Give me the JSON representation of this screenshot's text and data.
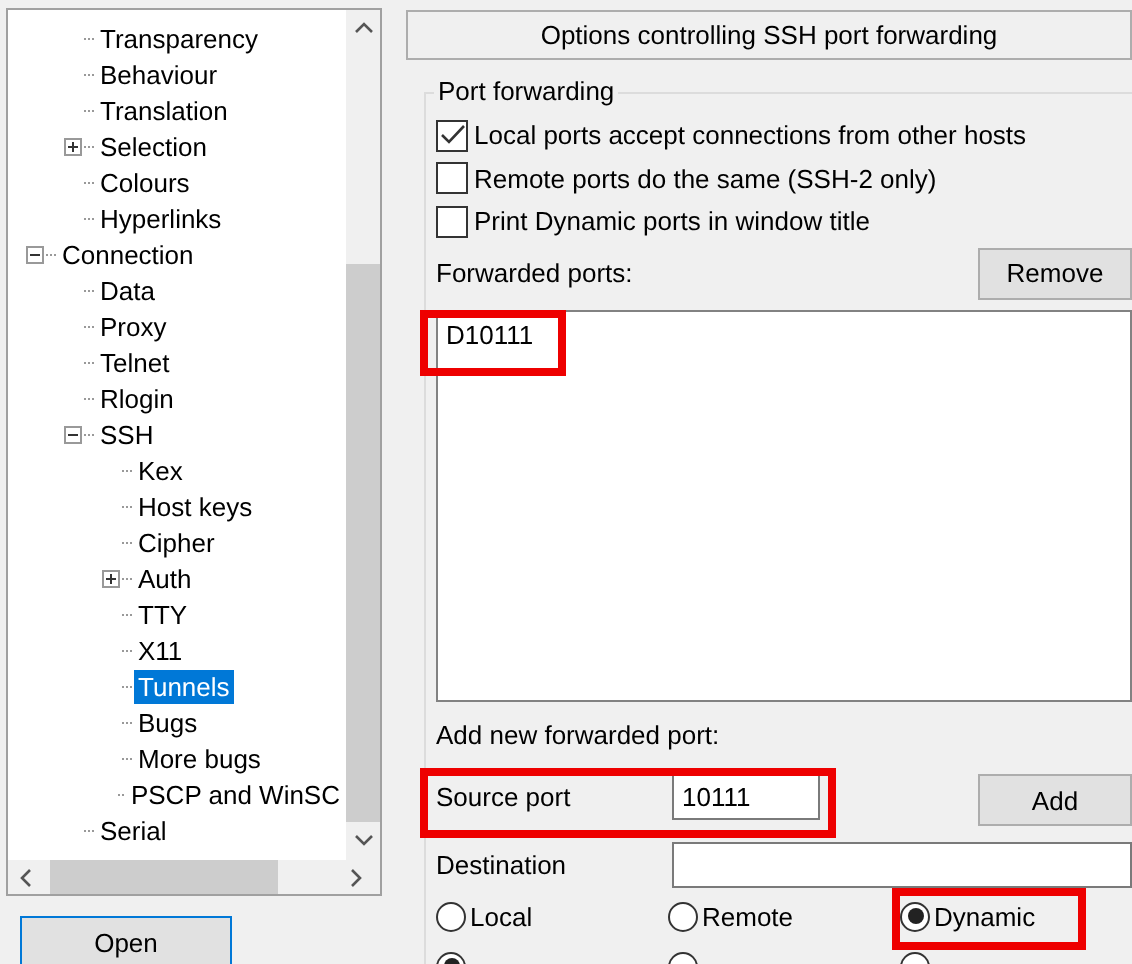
{
  "tree": [
    {
      "children": [
        {
          "label": "Transparency",
          "selected": false
        },
        {
          "label": "Behaviour",
          "selected": false
        },
        {
          "label": "Translation",
          "selected": false
        },
        {
          "label": "Selection",
          "selected": false,
          "expanded": false
        },
        {
          "label": "Colours",
          "selected": false
        },
        {
          "label": "Hyperlinks",
          "selected": false
        }
      ]
    },
    {
      "label": "Connection",
      "selected": false,
      "expanded": true,
      "children": [
        {
          "label": "Data",
          "selected": false
        },
        {
          "label": "Proxy",
          "selected": false
        },
        {
          "label": "Telnet",
          "selected": false
        },
        {
          "label": "Rlogin",
          "selected": false
        },
        {
          "label": "SSH",
          "selected": false,
          "expanded": true,
          "children": [
            {
              "label": "Kex",
              "selected": false
            },
            {
              "label": "Host keys",
              "selected": false
            },
            {
              "label": "Cipher",
              "selected": false
            },
            {
              "label": "Auth",
              "selected": false,
              "expanded": false
            },
            {
              "label": "TTY",
              "selected": false
            },
            {
              "label": "X11",
              "selected": false
            },
            {
              "label": "Tunnels",
              "selected": true
            },
            {
              "label": "Bugs",
              "selected": false
            },
            {
              "label": "More bugs",
              "selected": false
            },
            {
              "label": "PSCP and WinSC",
              "selected": false
            }
          ]
        },
        {
          "label": "Serial",
          "selected": false
        }
      ]
    }
  ],
  "open_button": "Open",
  "header": "Options controlling SSH port forwarding",
  "group_title": "Port forwarding",
  "options": [
    {
      "label": "Local ports accept connections from other hosts",
      "checked": true
    },
    {
      "label": "Remote ports do the same (SSH-2 only)",
      "checked": false
    },
    {
      "label": "Print Dynamic ports in window title",
      "checked": false
    }
  ],
  "forwarded_label": "Forwarded ports:",
  "remove_button": "Remove",
  "forwarded_ports": [
    "D10111"
  ],
  "add_label": "Add new forwarded port:",
  "source_label": "Source port",
  "source_value": "10111",
  "add_button": "Add",
  "destination_label": "Destination",
  "direction": [
    {
      "label": "Local",
      "selected": false
    },
    {
      "label": "Remote",
      "selected": false
    },
    {
      "label": "Dynamic",
      "selected": true
    }
  ],
  "ip_version": [
    {
      "selected": true
    },
    {
      "selected": false
    },
    {
      "selected": false
    }
  ]
}
